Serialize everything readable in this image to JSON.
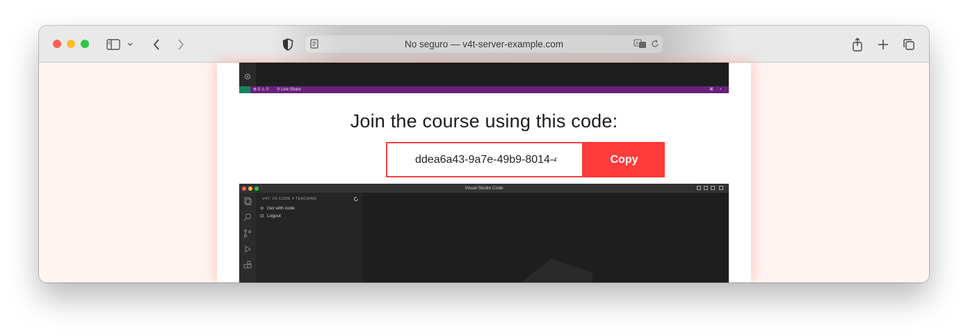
{
  "browser": {
    "address_bar_text": "No seguro — v4t-server-example.com",
    "icons": [
      "sidebar-icon",
      "chevron-down-icon",
      "back-icon",
      "forward-icon",
      "shield-icon",
      "reader-icon",
      "translate-icon",
      "reload-icon",
      "share-icon",
      "new-tab-icon",
      "tabs-overview-icon"
    ],
    "traffic_light_colors": [
      "#ff5f57",
      "#febc2e",
      "#28c840"
    ]
  },
  "page": {
    "heading": "Join the course using this code:",
    "course_code": "ddea6a43-9a7e-49b9-8014-4",
    "copy_label": "Copy",
    "accent_color": "#ff3b3b"
  },
  "vscode_top": {
    "status_text": "⊗ 0 ⚠ 0",
    "live_share": "Live Share"
  },
  "vscode_bottom": {
    "window_title": "Visual Studio Code",
    "panel_title": "V4T: VS CODE 4 TEACHING",
    "items": [
      {
        "label": "Get with code",
        "icon": "link-icon"
      },
      {
        "label": "Logout",
        "icon": "logout-icon"
      }
    ]
  }
}
